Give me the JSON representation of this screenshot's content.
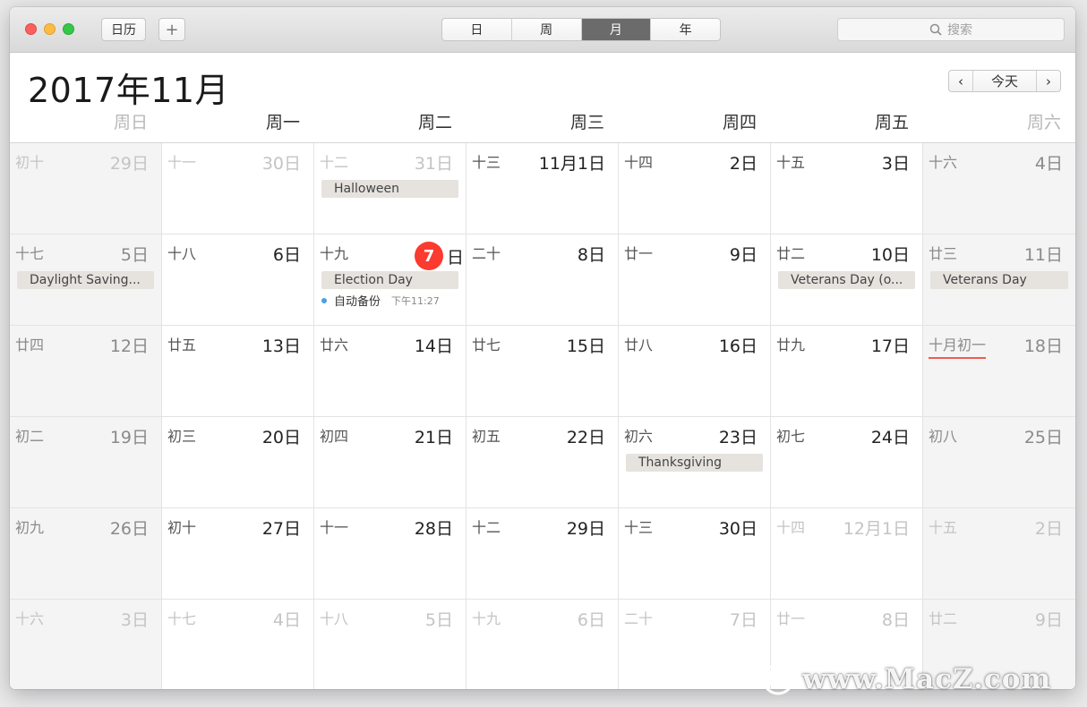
{
  "toolbar": {
    "calendars_label": "日历",
    "add_label": "+",
    "views": [
      {
        "label": "日",
        "active": false
      },
      {
        "label": "周",
        "active": false
      },
      {
        "label": "月",
        "active": true
      },
      {
        "label": "年",
        "active": false
      }
    ],
    "search_placeholder": "搜索"
  },
  "header": {
    "month_title": "2017年11月",
    "prev_label": "‹",
    "today_label": "今天",
    "next_label": "›"
  },
  "weekdays": [
    "周日",
    "周一",
    "周二",
    "周三",
    "周四",
    "周五",
    "周六"
  ],
  "weeks": [
    [
      {
        "lunar": "初十",
        "day": "29日",
        "other": true
      },
      {
        "lunar": "十一",
        "day": "30日",
        "other": true
      },
      {
        "lunar": "十二",
        "day": "31日",
        "other": true,
        "events": [
          "Halloween"
        ]
      },
      {
        "lunar": "十三",
        "day": "11月1日"
      },
      {
        "lunar": "十四",
        "day": "2日"
      },
      {
        "lunar": "十五",
        "day": "3日"
      },
      {
        "lunar": "十六",
        "day": "4日"
      }
    ],
    [
      {
        "lunar": "十七",
        "day": "5日",
        "events": [
          "Daylight Saving..."
        ]
      },
      {
        "lunar": "十八",
        "day": "6日"
      },
      {
        "lunar": "十九",
        "day": "日",
        "today_num": "7",
        "today": true,
        "events": [
          "Election Day"
        ],
        "timed": {
          "title": "自动备份",
          "time": "下午11:27"
        }
      },
      {
        "lunar": "二十",
        "day": "8日"
      },
      {
        "lunar": "廿一",
        "day": "9日"
      },
      {
        "lunar": "廿二",
        "day": "10日",
        "events": [
          "Veterans Day (o..."
        ]
      },
      {
        "lunar": "廿三",
        "day": "11日",
        "events": [
          "Veterans Day"
        ]
      }
    ],
    [
      {
        "lunar": "廿四",
        "day": "12日"
      },
      {
        "lunar": "廿五",
        "day": "13日"
      },
      {
        "lunar": "廿六",
        "day": "14日"
      },
      {
        "lunar": "廿七",
        "day": "15日"
      },
      {
        "lunar": "廿八",
        "day": "16日"
      },
      {
        "lunar": "廿九",
        "day": "17日"
      },
      {
        "lunar": "十月初一",
        "day": "18日",
        "festival": true
      }
    ],
    [
      {
        "lunar": "初二",
        "day": "19日"
      },
      {
        "lunar": "初三",
        "day": "20日"
      },
      {
        "lunar": "初四",
        "day": "21日"
      },
      {
        "lunar": "初五",
        "day": "22日"
      },
      {
        "lunar": "初六",
        "day": "23日",
        "events": [
          "Thanksgiving"
        ]
      },
      {
        "lunar": "初七",
        "day": "24日"
      },
      {
        "lunar": "初八",
        "day": "25日"
      }
    ],
    [
      {
        "lunar": "初九",
        "day": "26日"
      },
      {
        "lunar": "初十",
        "day": "27日"
      },
      {
        "lunar": "十一",
        "day": "28日"
      },
      {
        "lunar": "十二",
        "day": "29日"
      },
      {
        "lunar": "十三",
        "day": "30日"
      },
      {
        "lunar": "十四",
        "day": "12月1日",
        "other": true
      },
      {
        "lunar": "十五",
        "day": "2日",
        "other": true
      }
    ],
    [
      {
        "lunar": "十六",
        "day": "3日",
        "other": true
      },
      {
        "lunar": "十七",
        "day": "4日",
        "other": true
      },
      {
        "lunar": "十八",
        "day": "5日",
        "other": true
      },
      {
        "lunar": "十九",
        "day": "6日",
        "other": true
      },
      {
        "lunar": "二十",
        "day": "7日",
        "other": true
      },
      {
        "lunar": "廿一",
        "day": "8日",
        "other": true
      },
      {
        "lunar": "廿二",
        "day": "9日",
        "other": true
      }
    ]
  ],
  "watermark": {
    "text": "www.MacZ.com"
  },
  "colors": {
    "today": "#fb3a30",
    "event_bg": "#e6e3df",
    "timed_dot": "#4a9fe6",
    "festival_underline": "#f25a53"
  }
}
